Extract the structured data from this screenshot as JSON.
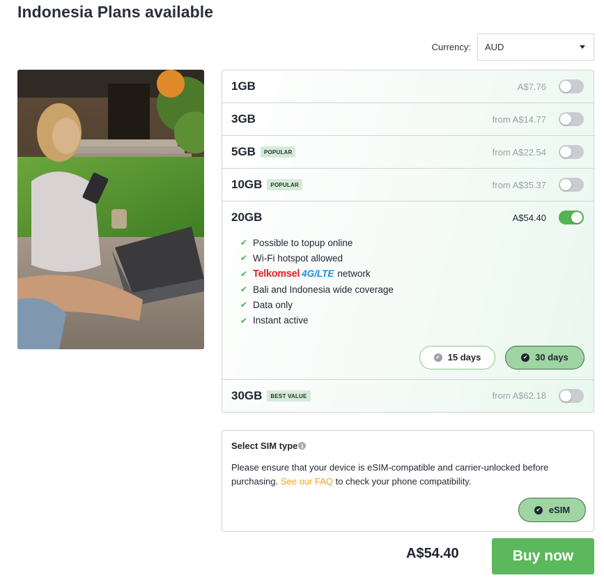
{
  "page": {
    "title": "Indonesia Plans available"
  },
  "currency": {
    "label": "Currency:",
    "selected": "AUD"
  },
  "plans": [
    {
      "name": "1GB",
      "badge": "",
      "price": "A$7.76",
      "enabled": false
    },
    {
      "name": "3GB",
      "badge": "",
      "price": "from A$14.77",
      "enabled": false
    },
    {
      "name": "5GB",
      "badge": "POPULAR",
      "price": "from A$22.54",
      "enabled": false
    },
    {
      "name": "10GB",
      "badge": "POPULAR",
      "price": "from A$35.37",
      "enabled": false
    },
    {
      "name": "20GB",
      "badge": "",
      "price": "A$54.40",
      "enabled": true
    },
    {
      "name": "30GB",
      "badge": "BEST VALUE",
      "price": "from A$62.18",
      "enabled": false
    }
  ],
  "expanded_plan": {
    "features": [
      "Possible to topup online",
      "Wi-Fi hotspot allowed",
      "Bali and Indonesia wide coverage",
      "Data only",
      "Instant active"
    ],
    "network": {
      "carrier": "Telkomsel",
      "tech": "4G/LTE",
      "suffix": "network"
    },
    "durations": [
      {
        "label": "15 days",
        "selected": false
      },
      {
        "label": "30 days",
        "selected": true
      }
    ]
  },
  "sim": {
    "title": "Select SIM type",
    "info_icon": "i",
    "text_before": "Please ensure that your device is eSIM-compatible and carrier-unlocked before purchasing. ",
    "link": "See our FAQ",
    "text_after": " to check your phone compatibility.",
    "option": "eSIM"
  },
  "footer": {
    "total": "A$54.40",
    "buy_label": "Buy now"
  },
  "colors": {
    "accent_green": "#5cb85c",
    "toggle_on": "#54b24f",
    "link_orange": "#f0a51e",
    "telkomsel_red": "#e4202a",
    "lte_blue": "#1a8fe0"
  },
  "icons": {
    "check": "check-icon",
    "caret": "chevron-down-icon",
    "checked_circle": "check-circle-icon",
    "info": "info-icon"
  }
}
